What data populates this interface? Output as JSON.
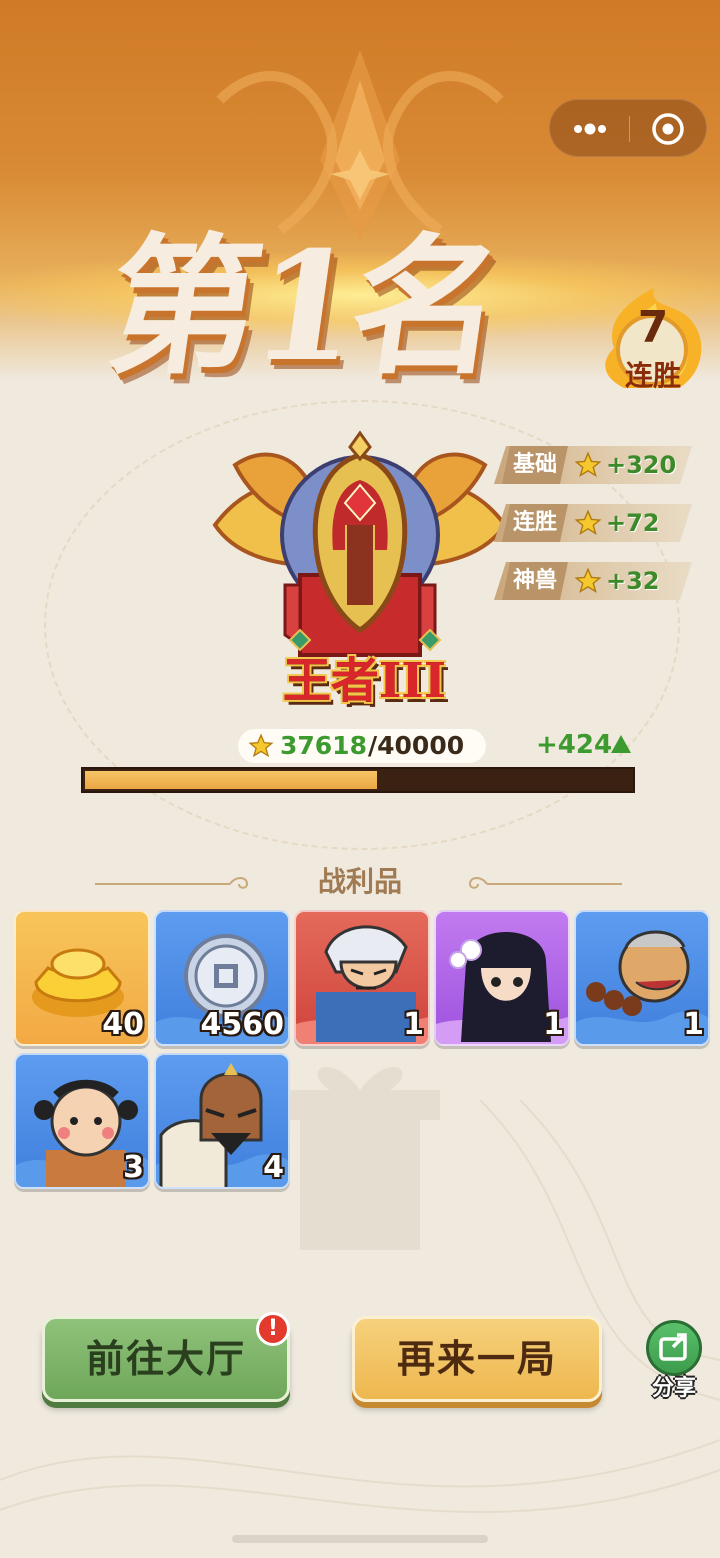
{
  "header": {
    "rank_title": "第1名",
    "streak_count": "7",
    "streak_label": "连胜"
  },
  "capsule": {
    "menu_icon": "more-dots-icon",
    "close_icon": "target-circle-icon"
  },
  "rank": {
    "name": "王者III"
  },
  "bonuses": [
    {
      "label": "基础",
      "value": "+320",
      "icon": "star-icon"
    },
    {
      "label": "连胜",
      "value": "+72",
      "icon": "star-icon"
    },
    {
      "label": "神兽",
      "value": "+32",
      "icon": "star-icon"
    }
  ],
  "score": {
    "current": "37618",
    "max": "/40000",
    "gain": "+424",
    "progress_fraction": 0.534
  },
  "rewards": {
    "title": "战利品",
    "items": [
      {
        "name": "gold-ingot",
        "count": "40",
        "tile": "gold"
      },
      {
        "name": "silver-coin",
        "count": "4560",
        "tile": "blue"
      },
      {
        "name": "hero-white-hair",
        "count": "1",
        "tile": "red"
      },
      {
        "name": "hero-girl",
        "count": "1",
        "tile": "purple"
      },
      {
        "name": "hero-monk",
        "count": "1",
        "tile": "blue"
      },
      {
        "name": "hero-child",
        "count": "3",
        "tile": "blue"
      },
      {
        "name": "hero-warrior",
        "count": "4",
        "tile": "blue"
      }
    ]
  },
  "buttons": {
    "lobby": "前往大厅",
    "lobby_badge": "!",
    "again": "再来一局",
    "share": "分享"
  },
  "colors": {
    "accent_green": "#3d9a2e",
    "banner_orange": "#d98a34",
    "progress_fill": "#eaa642"
  }
}
